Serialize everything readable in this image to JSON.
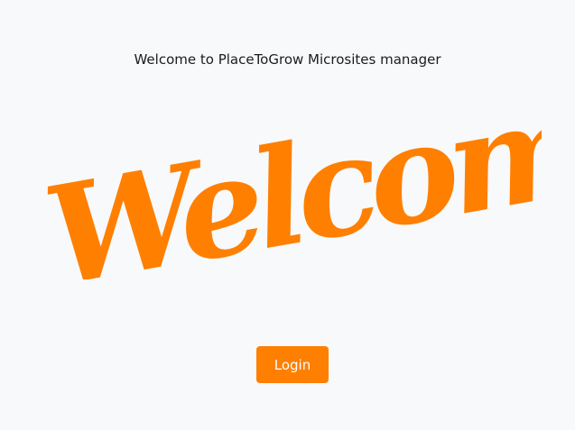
{
  "header": {
    "subtitle": "Welcome to PlaceToGrow Microsites manager"
  },
  "hero": {
    "text": "Welcome",
    "color": "#ff7f00"
  },
  "actions": {
    "login_label": "Login",
    "login_color": "#ff7f00"
  }
}
